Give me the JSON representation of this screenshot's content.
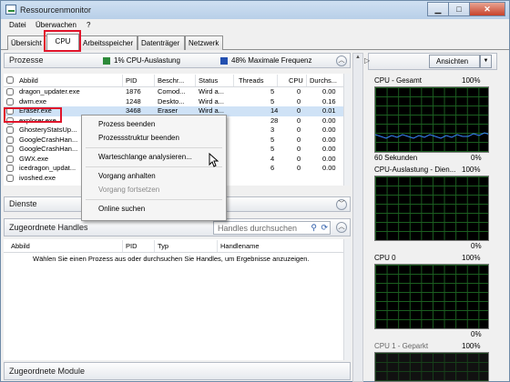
{
  "window": {
    "title": "Ressourcenmonitor"
  },
  "menu": {
    "items": [
      "Datei",
      "Überwachen",
      "?"
    ]
  },
  "tabs": [
    "Übersicht",
    "CPU",
    "Arbeitsspeicher",
    "Datenträger",
    "Netzwerk"
  ],
  "active_tab": "CPU",
  "processes": {
    "title": "Prozesse",
    "cpu_usage": "1% CPU-Auslastung",
    "max_freq": "48% Maximale Frequenz",
    "columns": [
      "Abbild",
      "PID",
      "Beschr...",
      "Status",
      "Threads",
      "CPU",
      "Durchs..."
    ],
    "rows": [
      {
        "name": "dragon_updater.exe",
        "pid": "1876",
        "desc": "Comod...",
        "status": "Wird a...",
        "threads": "5",
        "cpu": "0",
        "avg": "0.00"
      },
      {
        "name": "dwm.exe",
        "pid": "1248",
        "desc": "Deskto...",
        "status": "Wird a...",
        "threads": "5",
        "cpu": "0",
        "avg": "0.16"
      },
      {
        "name": "Eraser.exe",
        "pid": "3468",
        "desc": "Eraser",
        "status": "Wird a...",
        "threads": "14",
        "cpu": "0",
        "avg": "0.01"
      },
      {
        "name": "explorer.exe",
        "pid": "",
        "desc": "",
        "status": "",
        "threads": "28",
        "cpu": "0",
        "avg": "0.00"
      },
      {
        "name": "GhosteryStatsUp...",
        "pid": "",
        "desc": "",
        "status": "",
        "threads": "3",
        "cpu": "0",
        "avg": "0.00"
      },
      {
        "name": "GoogleCrashHan...",
        "pid": "",
        "desc": "",
        "status": "",
        "threads": "5",
        "cpu": "0",
        "avg": "0.00"
      },
      {
        "name": "GoogleCrashHan...",
        "pid": "",
        "desc": "",
        "status": "",
        "threads": "5",
        "cpu": "0",
        "avg": "0.00"
      },
      {
        "name": "GWX.exe",
        "pid": "",
        "desc": "",
        "status": "",
        "threads": "4",
        "cpu": "0",
        "avg": "0.00"
      },
      {
        "name": "icedragon_updat...",
        "pid": "",
        "desc": "",
        "status": "",
        "threads": "6",
        "cpu": "0",
        "avg": "0.00"
      },
      {
        "name": "ivoshed.exe",
        "pid": "",
        "desc": "",
        "status": "",
        "threads": "",
        "cpu": "",
        "avg": ""
      }
    ]
  },
  "context_menu": {
    "items": [
      {
        "label": "Prozess beenden",
        "disabled": false
      },
      {
        "label": "Prozessstruktur beenden",
        "disabled": false
      },
      {
        "label": "Warteschlange analysieren...",
        "disabled": false
      },
      {
        "label": "Vorgang anhalten",
        "disabled": false
      },
      {
        "label": "Vorgang fortsetzen",
        "disabled": true
      },
      {
        "label": "Online suchen",
        "disabled": false
      }
    ]
  },
  "services": {
    "title": "Dienste"
  },
  "handles": {
    "title": "Zugeordnete Handles",
    "search_placeholder": "Handles durchsuchen",
    "columns": [
      "Abbild",
      "PID",
      "Typ",
      "Handlename"
    ],
    "empty_message": "Wählen Sie einen Prozess aus oder durchsuchen Sie Handles, um Ergebnisse anzuzeigen."
  },
  "modules": {
    "title": "Zugeordnete Module"
  },
  "graphs": {
    "views_button": "Ansichten",
    "footer_left": "60 Sekunden",
    "items": [
      {
        "title": "CPU - Gesamt",
        "max": "100%",
        "min": "0%"
      },
      {
        "title": "CPU-Auslastung - Dien...",
        "max": "100%",
        "min": "0%"
      },
      {
        "title": "CPU 0",
        "max": "100%",
        "min": "0%"
      },
      {
        "title": "CPU 1 - Geparkt",
        "max": "100%",
        "min": "0%"
      }
    ]
  },
  "colors": {
    "accent_red": "#e0142a",
    "cpu_green": "#2d8a3a",
    "freq_blue": "#2350b0",
    "graph_bg": "#000000",
    "graph_line": "#3a86ff"
  }
}
